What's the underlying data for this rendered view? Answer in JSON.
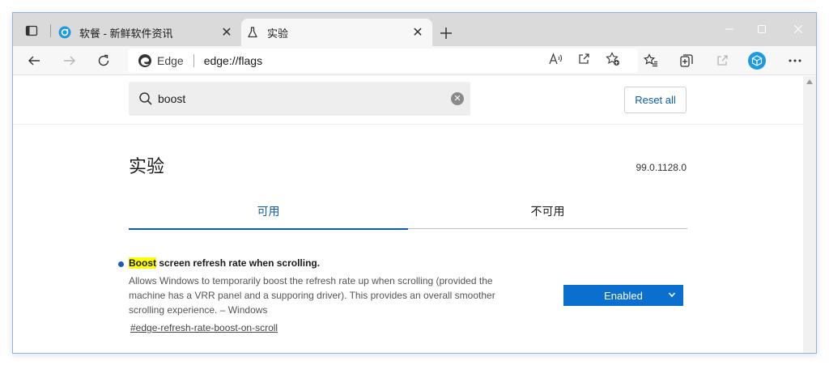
{
  "tabs": [
    {
      "title": "软餐 - 新鲜软件资讯",
      "favicon": "ruancan-logo-icon"
    },
    {
      "title": "实验",
      "favicon": "flask-icon"
    }
  ],
  "toolbar": {
    "site_name": "Edge",
    "url": "edge://flags"
  },
  "search": {
    "value": "boost",
    "reset_label": "Reset all"
  },
  "page": {
    "title": "实验",
    "version": "99.0.1128.0",
    "tabs": [
      "可用",
      "不可用"
    ]
  },
  "flag": {
    "name_highlight": "Boost",
    "name_rest": " screen refresh rate when scrolling.",
    "description": "Allows Windows to temporarily boost the refresh rate up when scrolling (provided the machine has a VRR panel and a supporing driver). This provides an overall smoother scrolling experience. – Windows",
    "link": "#edge-refresh-rate-boost-on-scroll",
    "state": "Enabled"
  },
  "colors": {
    "accent": "#0b6fd0",
    "highlight": "#ffff00",
    "profile": "#1e9be0"
  }
}
